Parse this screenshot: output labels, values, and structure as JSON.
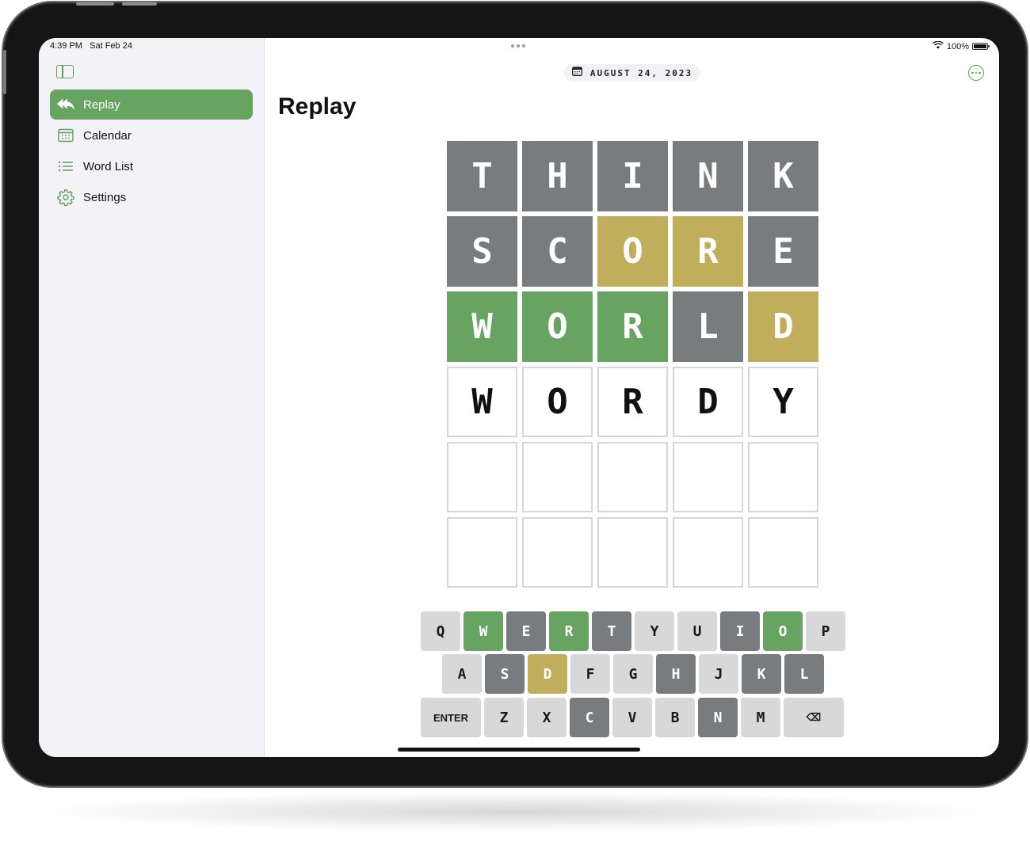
{
  "status": {
    "time": "4:39 PM",
    "date": "Sat Feb 24",
    "battery": "100%",
    "battery_level": 1.0
  },
  "sidebar": {
    "items": [
      {
        "label": "Replay",
        "icon": "reply-all-icon",
        "active": true
      },
      {
        "label": "Calendar",
        "icon": "calendar-icon",
        "active": false
      },
      {
        "label": "Word List",
        "icon": "list-icon",
        "active": false
      },
      {
        "label": "Settings",
        "icon": "gear-icon",
        "active": false
      }
    ]
  },
  "header": {
    "date": "AUGUST 24, 2023",
    "title": "Replay"
  },
  "board": {
    "rows": [
      [
        {
          "l": "T",
          "s": "gray"
        },
        {
          "l": "H",
          "s": "gray"
        },
        {
          "l": "I",
          "s": "gray"
        },
        {
          "l": "N",
          "s": "gray"
        },
        {
          "l": "K",
          "s": "gray"
        }
      ],
      [
        {
          "l": "S",
          "s": "gray"
        },
        {
          "l": "C",
          "s": "gray"
        },
        {
          "l": "O",
          "s": "yellow"
        },
        {
          "l": "R",
          "s": "yellow"
        },
        {
          "l": "E",
          "s": "gray"
        }
      ],
      [
        {
          "l": "W",
          "s": "green"
        },
        {
          "l": "O",
          "s": "green"
        },
        {
          "l": "R",
          "s": "green"
        },
        {
          "l": "L",
          "s": "gray"
        },
        {
          "l": "D",
          "s": "yellow"
        }
      ],
      [
        {
          "l": "W",
          "s": "typed"
        },
        {
          "l": "O",
          "s": "typed"
        },
        {
          "l": "R",
          "s": "typed"
        },
        {
          "l": "D",
          "s": "typed"
        },
        {
          "l": "Y",
          "s": "typed"
        }
      ],
      [
        {
          "l": "",
          "s": "empty"
        },
        {
          "l": "",
          "s": "empty"
        },
        {
          "l": "",
          "s": "empty"
        },
        {
          "l": "",
          "s": "empty"
        },
        {
          "l": "",
          "s": "empty"
        }
      ],
      [
        {
          "l": "",
          "s": "empty"
        },
        {
          "l": "",
          "s": "empty"
        },
        {
          "l": "",
          "s": "empty"
        },
        {
          "l": "",
          "s": "empty"
        },
        {
          "l": "",
          "s": "empty"
        }
      ]
    ]
  },
  "keyboard": {
    "rows": [
      [
        {
          "k": "Q",
          "s": "none"
        },
        {
          "k": "W",
          "s": "green"
        },
        {
          "k": "E",
          "s": "gray"
        },
        {
          "k": "R",
          "s": "green"
        },
        {
          "k": "T",
          "s": "gray"
        },
        {
          "k": "Y",
          "s": "none"
        },
        {
          "k": "U",
          "s": "none"
        },
        {
          "k": "I",
          "s": "gray"
        },
        {
          "k": "O",
          "s": "green"
        },
        {
          "k": "P",
          "s": "none"
        }
      ],
      [
        {
          "k": "A",
          "s": "none"
        },
        {
          "k": "S",
          "s": "gray"
        },
        {
          "k": "D",
          "s": "yellow"
        },
        {
          "k": "F",
          "s": "none"
        },
        {
          "k": "G",
          "s": "none"
        },
        {
          "k": "H",
          "s": "gray"
        },
        {
          "k": "J",
          "s": "none"
        },
        {
          "k": "K",
          "s": "gray"
        },
        {
          "k": "L",
          "s": "gray"
        }
      ],
      [
        {
          "k": "ENTER",
          "s": "none",
          "wide": true
        },
        {
          "k": "Z",
          "s": "none"
        },
        {
          "k": "X",
          "s": "none"
        },
        {
          "k": "C",
          "s": "gray"
        },
        {
          "k": "V",
          "s": "none"
        },
        {
          "k": "B",
          "s": "none"
        },
        {
          "k": "N",
          "s": "gray"
        },
        {
          "k": "M",
          "s": "none"
        },
        {
          "k": "⌫",
          "s": "none",
          "wide": true,
          "name": "backspace"
        }
      ]
    ]
  },
  "colors": {
    "green": "#67a461",
    "yellow": "#c0ae5c",
    "gray": "#787c7e",
    "key_default": "#d8d8d8"
  }
}
